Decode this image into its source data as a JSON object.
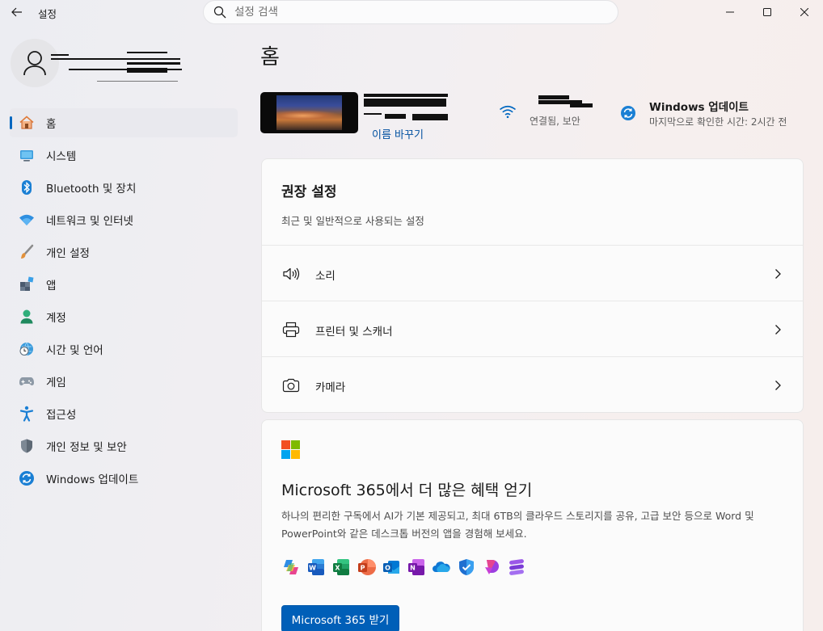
{
  "window": {
    "title": "설정",
    "search_placeholder": "설정 검색"
  },
  "sidebar": {
    "items": [
      {
        "label": "홈",
        "icon": "home-icon",
        "active": true
      },
      {
        "label": "시스템",
        "icon": "system-icon"
      },
      {
        "label": "Bluetooth 및 장치",
        "icon": "bluetooth-icon"
      },
      {
        "label": "네트워크 및 인터넷",
        "icon": "wifi-icon"
      },
      {
        "label": "개인 설정",
        "icon": "brush-icon"
      },
      {
        "label": "앱",
        "icon": "apps-icon"
      },
      {
        "label": "계정",
        "icon": "account-icon"
      },
      {
        "label": "시간 및 언어",
        "icon": "clock-globe-icon"
      },
      {
        "label": "게임",
        "icon": "gamepad-icon"
      },
      {
        "label": "접근성",
        "icon": "accessibility-icon"
      },
      {
        "label": "개인 정보 및 보안",
        "icon": "shield-icon"
      },
      {
        "label": "Windows 업데이트",
        "icon": "update-icon"
      }
    ]
  },
  "main": {
    "title": "홈",
    "device": {
      "rename_label": "이름 바꾸기"
    },
    "network": {
      "status": "연결됨, 보안"
    },
    "windows_update": {
      "title": "Windows 업데이트",
      "subtitle": "마지막으로 확인한 시간: 2시간 전"
    },
    "recommended": {
      "title": "권장 설정",
      "subtitle": "최근 및 일반적으로 사용되는 설정",
      "rows": [
        {
          "label": "소리",
          "icon": "speaker-icon"
        },
        {
          "label": "프린터 및 스캐너",
          "icon": "printer-icon"
        },
        {
          "label": "카메라",
          "icon": "camera-icon"
        }
      ]
    },
    "m365": {
      "title": "Microsoft 365에서 더 많은 혜택 얻기",
      "description": "하나의 편리한 구독에서 AI가 기본 제공되고, 최대 6TB의 클라우드 스토리지를 공유, 고급 보안 등으로 Word 및 PowerPoint와 같은 데스크톱 버전의 앱을 경험해 보세요.",
      "button_label": "Microsoft 365 받기",
      "apps": [
        "copilot-icon",
        "word-icon",
        "excel-icon",
        "powerpoint-icon",
        "outlook-icon",
        "onenote-icon",
        "onedrive-icon",
        "defender-icon",
        "designer-icon",
        "clipchamp-icon"
      ]
    }
  },
  "colors": {
    "accent": "#0067c0",
    "button": "#005fb8",
    "link": "#0050a0"
  }
}
